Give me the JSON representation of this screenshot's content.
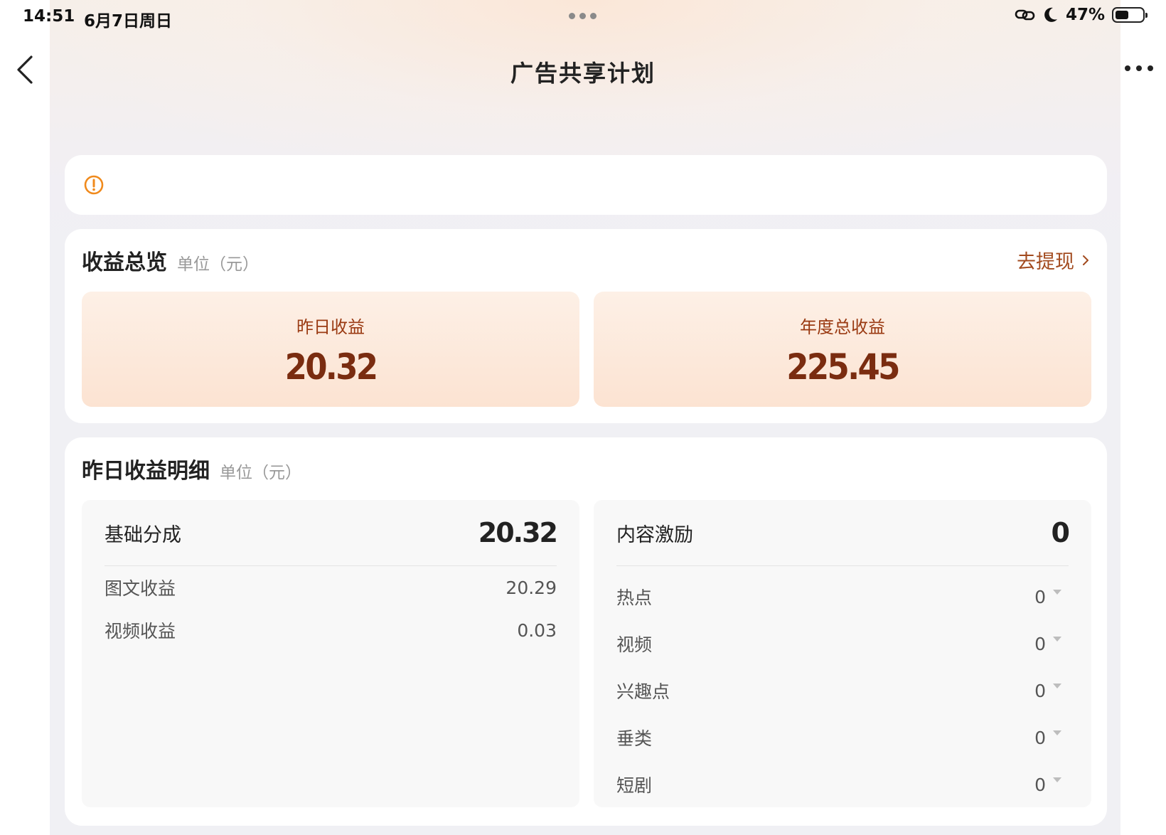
{
  "status_bar": {
    "time": "14:51",
    "date": "6月7日周日",
    "battery_text": "47%",
    "battery_level": 0.47
  },
  "nav": {
    "title": "广告共享计划"
  },
  "overview": {
    "title": "收益总览",
    "unit": "单位（元）",
    "withdraw_label": "去提现",
    "stats": [
      {
        "label": "昨日收益",
        "value": "20.32"
      },
      {
        "label": "年度总收益",
        "value": "225.45"
      }
    ]
  },
  "detail": {
    "title": "昨日收益明细",
    "unit": "单位（元）",
    "base": {
      "label": "基础分成",
      "value": "20.32",
      "rows": [
        {
          "label": "图文收益",
          "value": "20.29"
        },
        {
          "label": "视频收益",
          "value": "0.03"
        }
      ]
    },
    "incentive": {
      "label": "内容激励",
      "value": "0",
      "rows": [
        {
          "label": "热点",
          "value": "0"
        },
        {
          "label": "视频",
          "value": "0"
        },
        {
          "label": "兴趣点",
          "value": "0"
        },
        {
          "label": "垂类",
          "value": "0"
        },
        {
          "label": "短剧",
          "value": "0"
        }
      ]
    }
  },
  "colors": {
    "accent": "#a24a1e",
    "stat_value": "#7a2c10",
    "warning": "#f08a1c"
  },
  "icons": [
    "back-arrow-icon",
    "more-icon",
    "link-icon",
    "moon-icon",
    "battery-icon",
    "warning-icon",
    "chevron-right-icon",
    "caret-down-icon"
  ]
}
